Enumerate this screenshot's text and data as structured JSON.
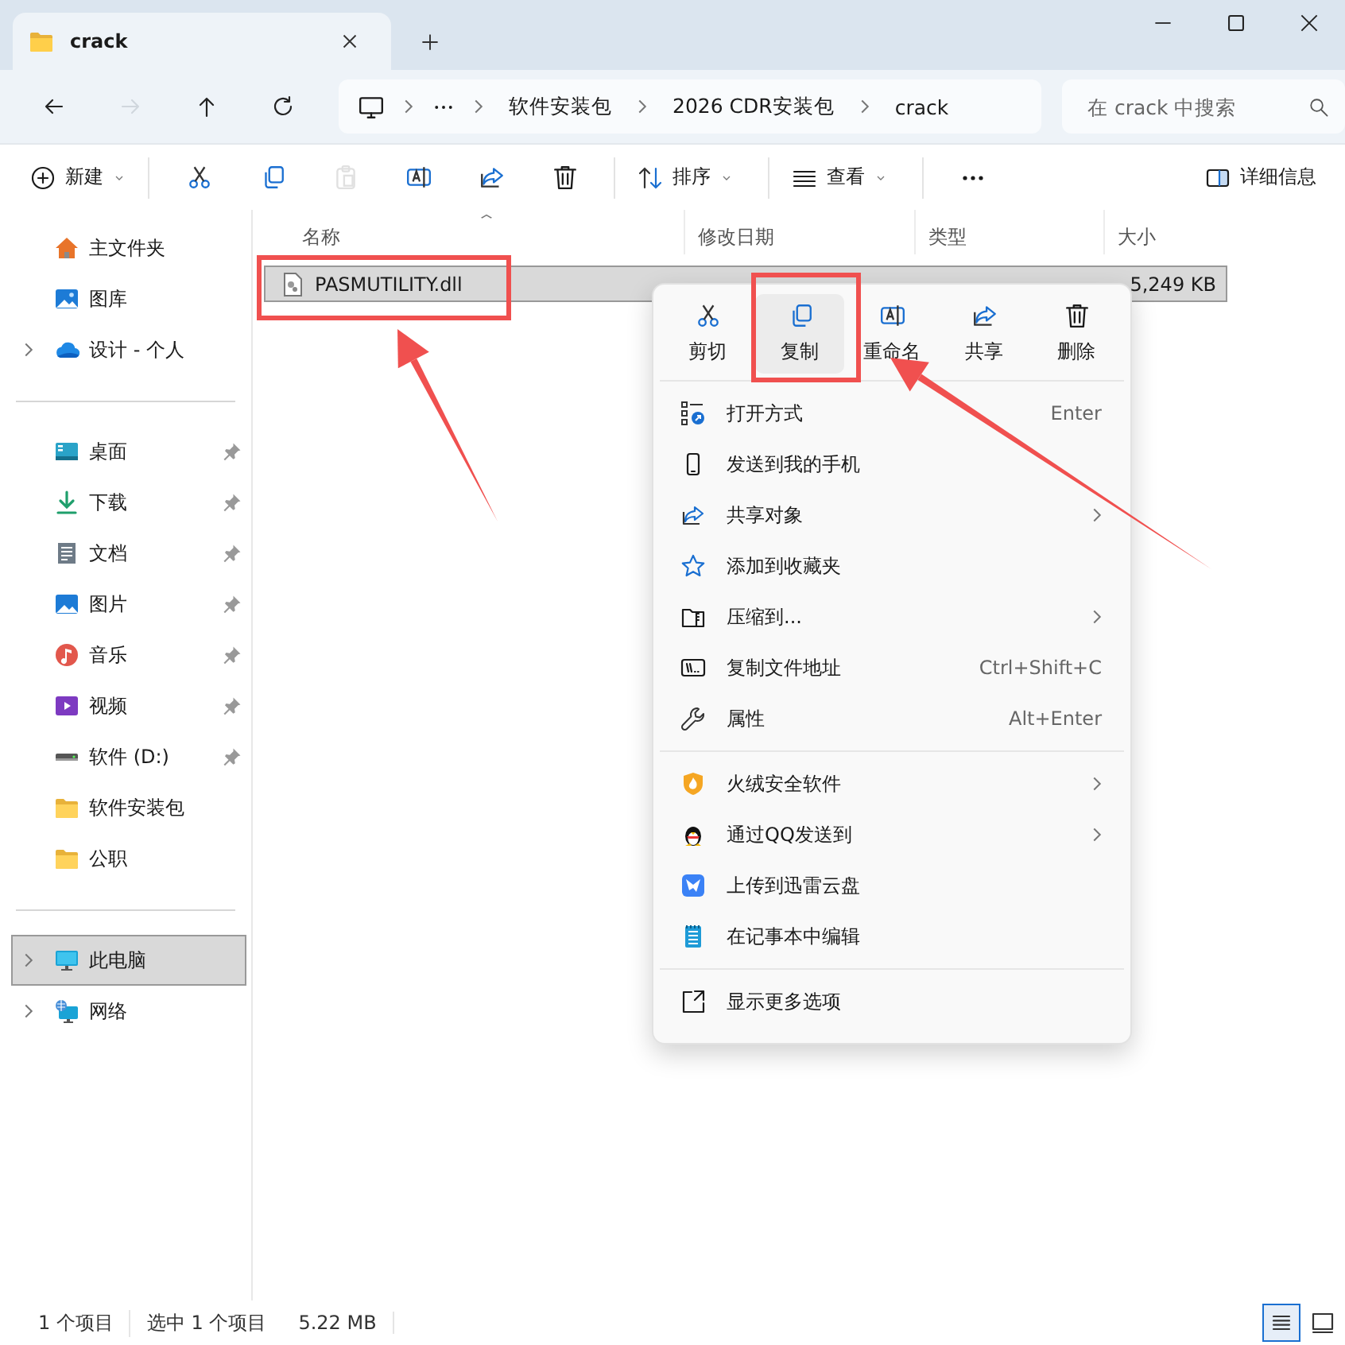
{
  "tab": {
    "title": "crack"
  },
  "nav": [
    {
      "kind": "back",
      "disabled": false
    },
    {
      "kind": "forward",
      "disabled": true
    },
    {
      "kind": "up",
      "disabled": false
    },
    {
      "kind": "refresh",
      "disabled": false
    }
  ],
  "breadcrumbs": [
    "软件安装包",
    "2026 CDR安装包",
    "crack"
  ],
  "search": {
    "placeholder": "在 crack 中搜索"
  },
  "toolbar": {
    "items": [
      {
        "kind": "new",
        "label": "新建",
        "disabled": false
      },
      {
        "kind": "cut",
        "disabled": false
      },
      {
        "kind": "copy",
        "disabled": false
      },
      {
        "kind": "paste",
        "disabled": true
      },
      {
        "kind": "rename",
        "disabled": false
      },
      {
        "kind": "share",
        "disabled": false
      },
      {
        "kind": "delete",
        "disabled": false
      },
      {
        "kind": "sort",
        "label": "排序",
        "disabled": false
      },
      {
        "kind": "view",
        "label": "查看",
        "disabled": false
      },
      {
        "kind": "more",
        "disabled": false
      }
    ],
    "details": "详细信息"
  },
  "sidebar": {
    "sections": [
      [
        {
          "kind": "home",
          "label": "主文件夹",
          "pinned": false,
          "expandable": false,
          "selected": false
        },
        {
          "kind": "gallery",
          "label": "图库",
          "pinned": false,
          "expandable": false,
          "selected": false
        },
        {
          "kind": "cloud",
          "label": "设计 - 个人",
          "pinned": false,
          "expandable": true,
          "selected": false
        }
      ],
      [
        {
          "kind": "desktop",
          "label": "桌面",
          "pinned": true,
          "expandable": false,
          "selected": false
        },
        {
          "kind": "download",
          "label": "下载",
          "pinned": true,
          "expandable": false,
          "selected": false
        },
        {
          "kind": "document",
          "label": "文档",
          "pinned": true,
          "expandable": false,
          "selected": false
        },
        {
          "kind": "pictures",
          "label": "图片",
          "pinned": true,
          "expandable": false,
          "selected": false
        },
        {
          "kind": "music",
          "label": "音乐",
          "pinned": true,
          "expandable": false,
          "selected": false
        },
        {
          "kind": "video",
          "label": "视频",
          "pinned": true,
          "expandable": false,
          "selected": false
        },
        {
          "kind": "drive",
          "label": "软件 (D:)",
          "pinned": true,
          "expandable": false,
          "selected": false
        },
        {
          "kind": "folder",
          "label": "软件安装包",
          "pinned": false,
          "expandable": false,
          "selected": false
        },
        {
          "kind": "folder",
          "label": "公职",
          "pinned": false,
          "expandable": false,
          "selected": false
        }
      ],
      [
        {
          "kind": "computer",
          "label": "此电脑",
          "pinned": false,
          "expandable": true,
          "selected": true
        },
        {
          "kind": "network",
          "label": "网络",
          "pinned": false,
          "expandable": true,
          "selected": false
        }
      ]
    ]
  },
  "file_list": {
    "columns": [
      {
        "label": "名称",
        "sorted": true
      },
      {
        "label": "修改日期",
        "sorted": false
      },
      {
        "label": "类型",
        "sorted": false
      },
      {
        "label": "大小",
        "sorted": false
      }
    ],
    "rows": [
      {
        "name": "PASMUTILITY.dll",
        "size": "5,249 KB",
        "selected": true
      }
    ]
  },
  "context_menu": {
    "actions": [
      {
        "kind": "cut",
        "label": "剪切",
        "selected": false
      },
      {
        "kind": "copy",
        "label": "复制",
        "selected": true
      },
      {
        "kind": "rename",
        "label": "重命名",
        "selected": false
      },
      {
        "kind": "share",
        "label": "共享",
        "selected": false
      },
      {
        "kind": "delete",
        "label": "删除",
        "selected": false
      }
    ],
    "groups": [
      [
        {
          "kind": "open-with",
          "label": "打开方式",
          "shortcut": "Enter",
          "submenu": false
        },
        {
          "kind": "phone",
          "label": "发送到我的手机",
          "submenu": false
        },
        {
          "kind": "share",
          "label": "共享对象",
          "submenu": true
        },
        {
          "kind": "star",
          "label": "添加到收藏夹",
          "submenu": false
        },
        {
          "kind": "zip",
          "label": "压缩到...",
          "submenu": true
        },
        {
          "kind": "path",
          "label": "复制文件地址",
          "shortcut": "Ctrl+Shift+C",
          "submenu": false
        },
        {
          "kind": "wrench",
          "label": "属性",
          "shortcut": "Alt+Enter",
          "submenu": false
        }
      ],
      [
        {
          "kind": "shield",
          "label": "火绒安全软件",
          "submenu": true
        },
        {
          "kind": "penguin",
          "label": "通过QQ发送到",
          "submenu": true
        },
        {
          "kind": "bird",
          "label": "上传到迅雷云盘",
          "submenu": false
        },
        {
          "kind": "notepad",
          "label": "在记事本中编辑",
          "submenu": false
        }
      ],
      [
        {
          "kind": "more-options",
          "label": "显示更多选项",
          "submenu": false
        }
      ]
    ]
  },
  "status_bar": {
    "items": [
      "1 个项目",
      "选中 1 个项目",
      "5.22 MB"
    ],
    "view_buttons": [
      {
        "kind": "details",
        "selected": true
      },
      {
        "kind": "tiles",
        "selected": false
      }
    ]
  }
}
